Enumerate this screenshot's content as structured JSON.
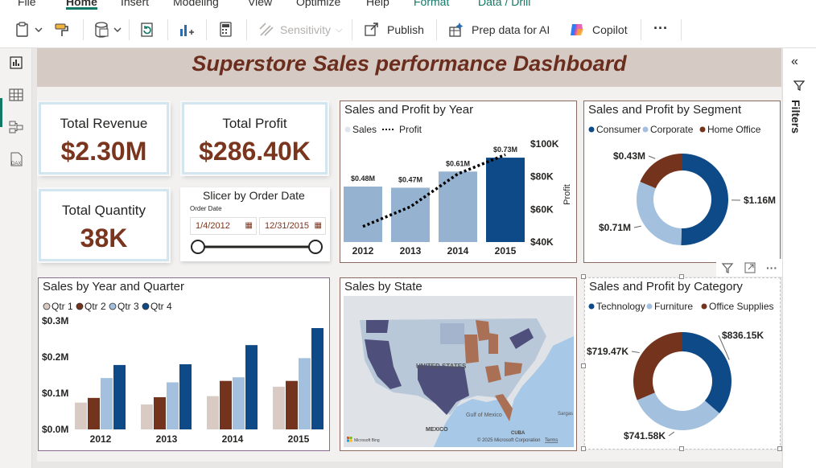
{
  "ribbon": {
    "menu": [
      "File",
      "Home",
      "Insert",
      "Modeling",
      "View",
      "Optimize",
      "Help",
      "Format",
      "Data / Drill"
    ],
    "active_menu": "Home",
    "toolbar": {
      "sensitivity_label": "Sensitivity",
      "publish_label": "Publish",
      "prep_data_label": "Prep data for AI",
      "copilot_label": "Copilot",
      "more_label": "···"
    }
  },
  "dashboard": {
    "title": "Superstore Sales performance Dashboard",
    "kpis": {
      "revenue_label": "Total Revenue",
      "revenue_value": "$2.30M",
      "profit_label": "Total Profit",
      "profit_value": "$286.40K",
      "quantity_label": "Total Quantity",
      "quantity_value": "38K"
    },
    "slicer": {
      "title": "Slicer by Order Date",
      "field_label": "Order Date",
      "start_date": "1/4/2012",
      "end_date": "12/31/2015"
    },
    "map": {
      "title": "Sales by State",
      "country_label": "UNITED STATES",
      "gulf_label": "Gulf of\nMexico",
      "mexico_label": "MEXICO",
      "cuba_label": "CUBA",
      "sargasso_label": "Sargas",
      "attribution": "© 2025 Microsoft Corporation",
      "terms": "Terms",
      "logo_text": "Microsoft Bing"
    },
    "filters_label": "Filters"
  },
  "colors": {
    "dark_blue": "#0e4a87",
    "light_blue": "#a3c1de",
    "brown": "#74331c",
    "beige": "#d9cbc3",
    "bar_light": "#95b2d1",
    "state_purple": "#4e4f7a",
    "state_brown": "#a97055"
  },
  "chart_data": [
    {
      "id": "sales_profit_by_year",
      "type": "bar",
      "title": "Sales and Profit by Year",
      "legend": [
        "Sales",
        "Profit"
      ],
      "categories": [
        "2012",
        "2013",
        "2014",
        "2015"
      ],
      "series": [
        {
          "name": "Sales",
          "type": "bar",
          "values": [
            0.48,
            0.47,
            0.61,
            0.73
          ],
          "labels": [
            "$0.48M",
            "$0.47M",
            "$0.61M",
            "$0.73M"
          ]
        },
        {
          "name": "Profit",
          "type": "line",
          "axis": "secondary",
          "values": [
            49500,
            61600,
            81700,
            93400
          ]
        }
      ],
      "secondary_axis": {
        "label": "Profit",
        "ticks": [
          "$40K",
          "$60K",
          "$80K",
          "$100K"
        ],
        "range": [
          40000,
          100000
        ]
      }
    },
    {
      "id": "sales_profit_by_segment",
      "type": "pie",
      "donut": true,
      "title": "Sales and Profit by Segment",
      "legend": [
        "Consumer",
        "Corporate",
        "Home Office"
      ],
      "values": [
        1.16,
        0.71,
        0.43
      ],
      "labels": [
        "$1.16M",
        "$0.71M",
        "$0.43M"
      ]
    },
    {
      "id": "sales_by_year_quarter",
      "type": "bar",
      "title": "Sales by Year and Quarter",
      "legend": [
        "Qtr 1",
        "Qtr 2",
        "Qtr 3",
        "Qtr 4"
      ],
      "categories": [
        "2012",
        "2013",
        "2014",
        "2015"
      ],
      "series": [
        {
          "name": "Qtr 1",
          "values": [
            0.074,
            0.069,
            0.092,
            0.118
          ]
        },
        {
          "name": "Qtr 2",
          "values": [
            0.087,
            0.089,
            0.134,
            0.134
          ]
        },
        {
          "name": "Qtr 3",
          "values": [
            0.142,
            0.13,
            0.144,
            0.197
          ]
        },
        {
          "name": "Qtr 4",
          "values": [
            0.178,
            0.18,
            0.233,
            0.28
          ]
        }
      ],
      "y_ticks": [
        "$0.0M",
        "$0.1M",
        "$0.2M",
        "$0.3M"
      ],
      "ylim": [
        0,
        0.3
      ]
    },
    {
      "id": "sales_profit_by_category",
      "type": "pie",
      "donut": true,
      "title": "Sales and Profit by Category",
      "legend": [
        "Technology",
        "Furniture",
        "Office Supplies"
      ],
      "values": [
        836.15,
        741.58,
        719.47
      ],
      "labels": [
        "$836.15K",
        "$741.58K",
        "$719.47K"
      ]
    }
  ]
}
